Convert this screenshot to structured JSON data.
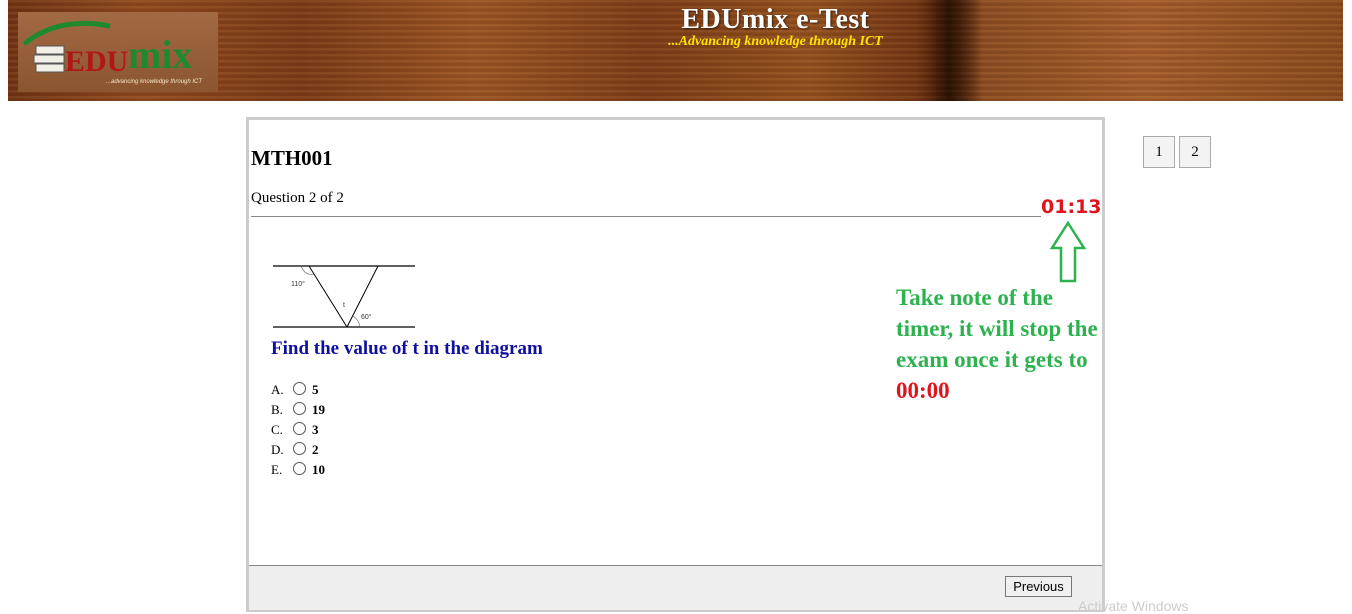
{
  "header": {
    "logo_text_edu": "EDU",
    "logo_text_mix": "mix",
    "logo_tagline": "...advancing knowledge through ICT",
    "title": "EDUmix e-Test",
    "tagline": "...Advancing knowledge through ICT"
  },
  "exam": {
    "course_code": "MTH001",
    "question_count": "Question 2 of 2",
    "timer": "01:13",
    "question_text": "Find the value of t in the diagram",
    "diagram_labels": {
      "angle_top": "110°",
      "angle_bottom": "60°",
      "unknown": "t"
    },
    "options": [
      {
        "letter": "A.",
        "value": "5"
      },
      {
        "letter": "B.",
        "value": "19"
      },
      {
        "letter": "C.",
        "value": "3"
      },
      {
        "letter": "D.",
        "value": "2"
      },
      {
        "letter": "E.",
        "value": "10"
      }
    ],
    "note_text": "Take note of the timer, it will stop the exam once it gets to ",
    "note_time": "00:00",
    "previous_label": "Previous"
  },
  "navigator": {
    "pages": [
      "1",
      "2"
    ]
  },
  "watermark": "Activate Windows",
  "colors": {
    "timer": "#e0141c",
    "note": "#2db24f",
    "question": "#1010a0",
    "tagline": "#ffe400"
  }
}
